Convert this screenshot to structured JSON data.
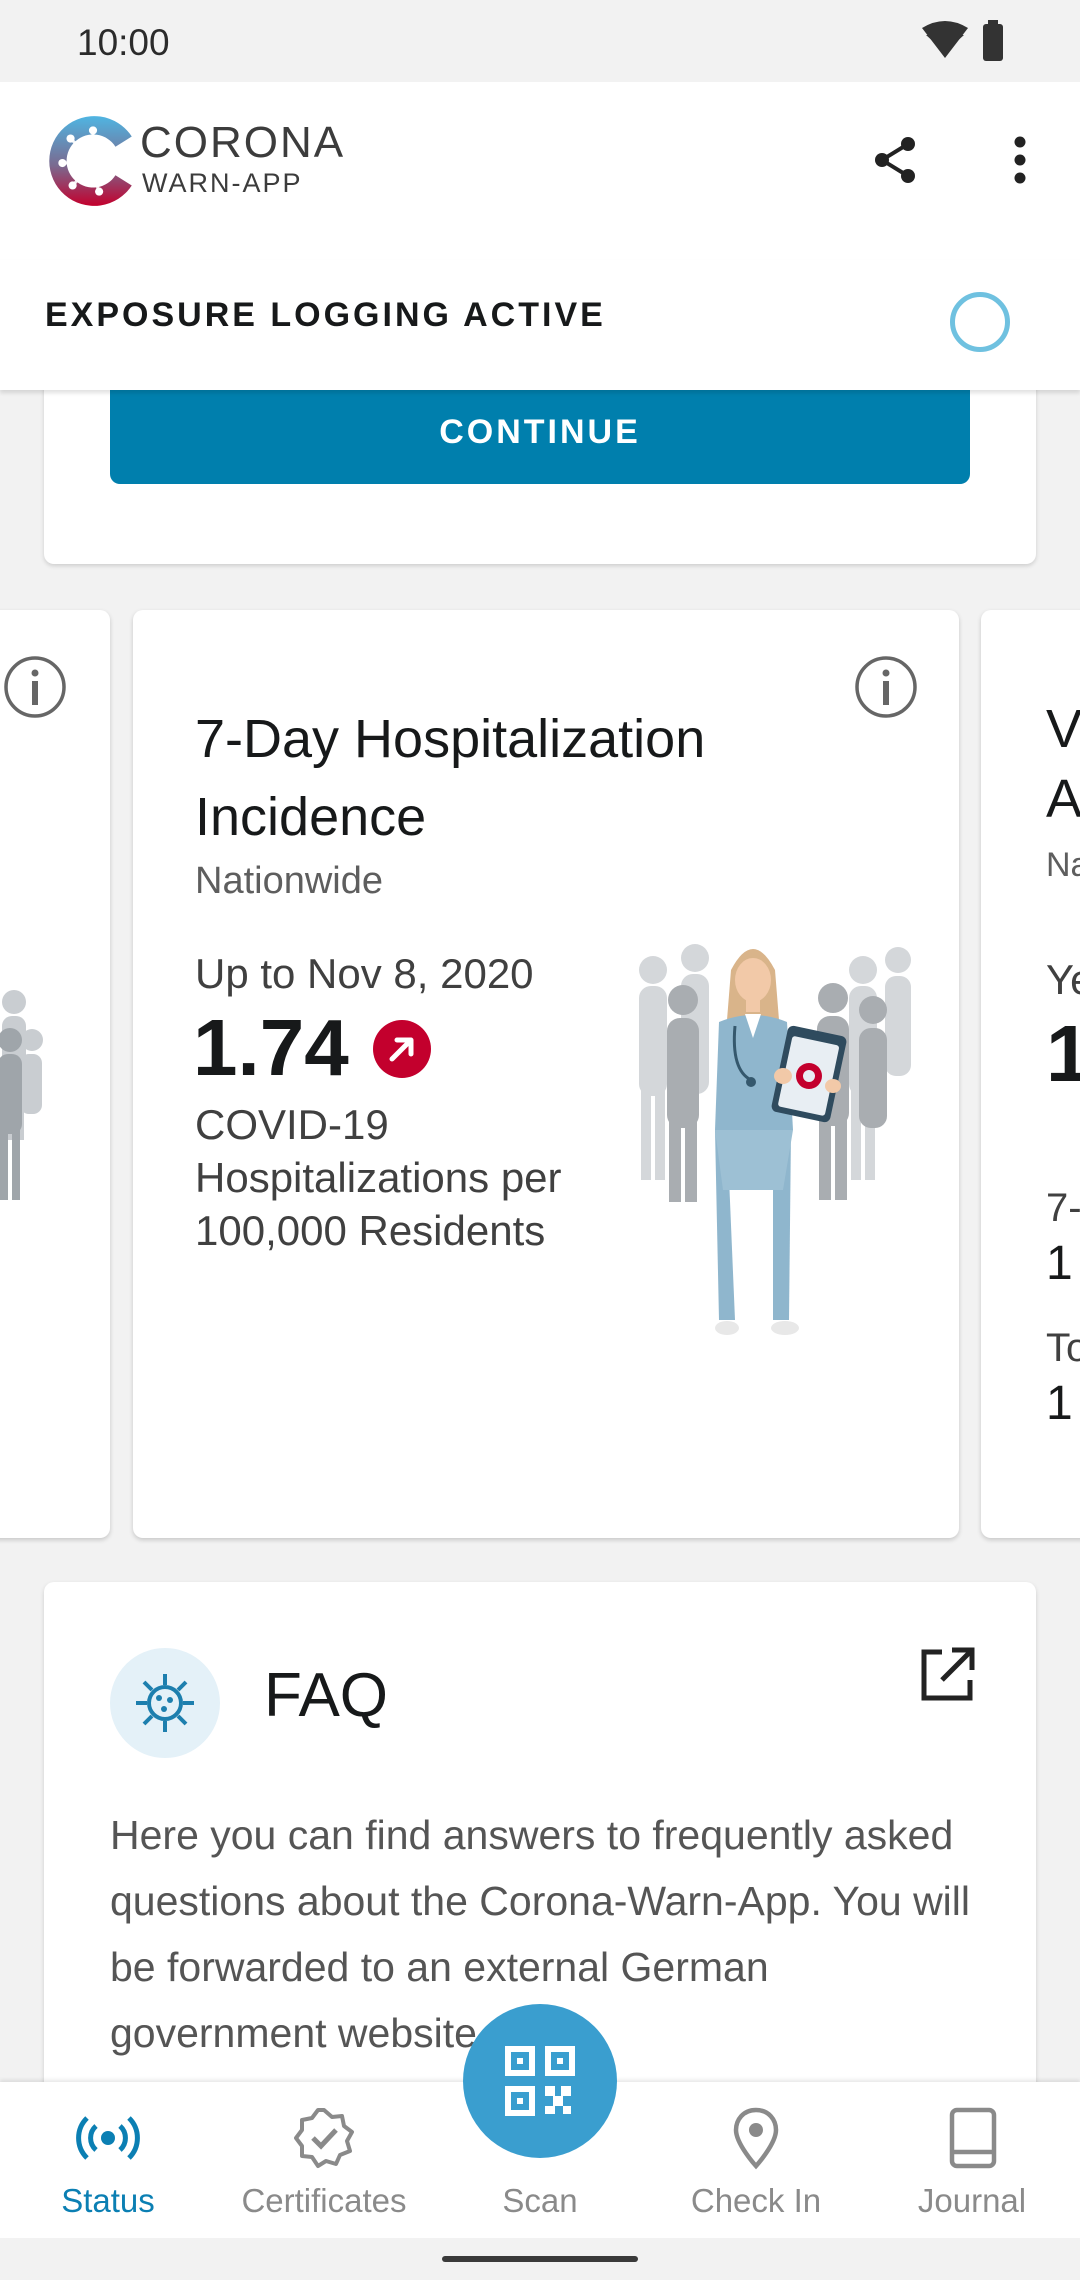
{
  "status_bar": {
    "time": "10:00",
    "icons": [
      "wifi-icon",
      "battery-icon"
    ]
  },
  "app_bar": {
    "brand_line1": "CORONA",
    "brand_line2": "WARN-APP",
    "actions": [
      "share-icon",
      "more-vert-icon"
    ]
  },
  "tracing": {
    "label": "EXPOSURE LOGGING ACTIVE",
    "status_icon": "tracing-ring-icon"
  },
  "top_card": {
    "button_label": "CONTINUE"
  },
  "statistics": {
    "main": {
      "title": "7-Day Hospitalization Incidence",
      "region": "Nationwide",
      "date": "Up to Nov 8, 2020",
      "value": "1.74",
      "trend": "increasing",
      "description": "COVID-19 Hospitalizations per 100,000 Residents"
    },
    "right_peek": {
      "title_l1": "V",
      "title_l2": "A",
      "region": "Na",
      "date": "Ye",
      "value": "1",
      "sub1_label": "7-",
      "sub1_value": "1",
      "sub2_label": "To",
      "sub2_value": "1"
    }
  },
  "faq": {
    "title": "FAQ",
    "body": "Here you can find answers to frequently asked questions about the Corona-Warn-App. You will be forwarded to an external German government website.",
    "icon": "virus-icon",
    "link_icon": "open-external-icon"
  },
  "bottom_nav": {
    "items": [
      {
        "label": "Status",
        "icon": "status-icon",
        "active": true
      },
      {
        "label": "Certificates",
        "icon": "certificate-icon",
        "active": false
      },
      {
        "label": "Scan",
        "icon": "qr-code-icon",
        "active": false
      },
      {
        "label": "Check In",
        "icon": "location-pin-icon",
        "active": false
      },
      {
        "label": "Journal",
        "icon": "journal-icon",
        "active": false
      }
    ]
  },
  "colors": {
    "primary": "#007fad",
    "accent_ring": "#6fc1e0",
    "trend_red": "#c3002d",
    "nav_active": "#0b7fb3"
  }
}
